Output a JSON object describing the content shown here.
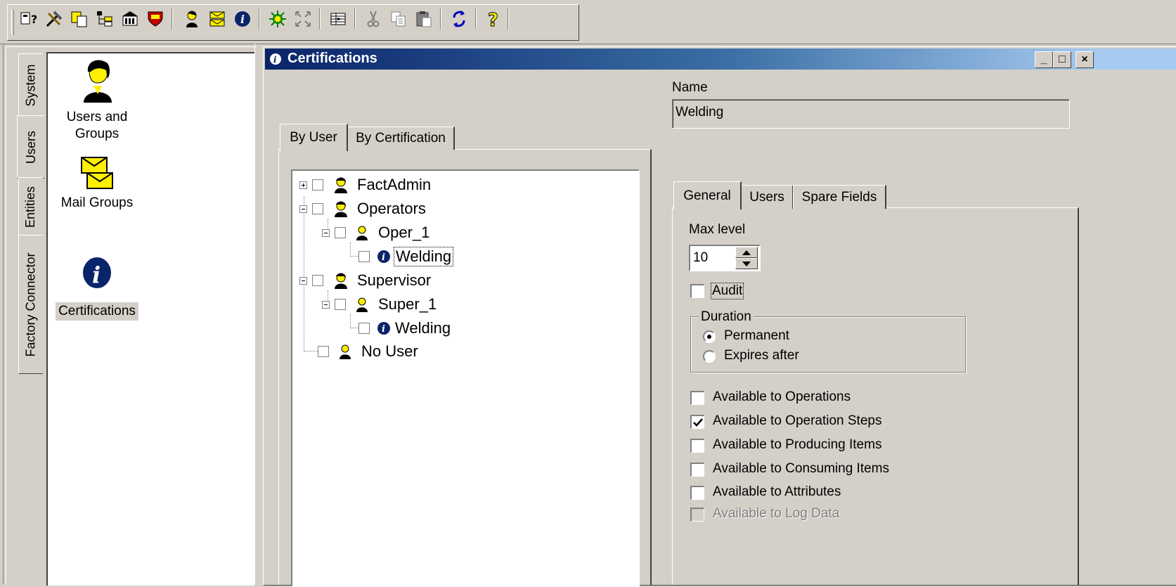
{
  "toolbar": {
    "buttons": [
      {
        "icon": "whats-this-icon"
      },
      {
        "icon": "tools-icon"
      },
      {
        "icon": "copy-objects-icon"
      },
      {
        "icon": "tree-icon"
      },
      {
        "icon": "building-icon"
      },
      {
        "icon": "shield-icon"
      },
      {
        "icon": "user-icon"
      },
      {
        "icon": "mail-icon"
      },
      {
        "icon": "info-icon"
      },
      {
        "icon": "gear-icon"
      },
      {
        "icon": "expand-icon"
      },
      {
        "icon": "grid-icon"
      },
      {
        "icon": "cut-icon"
      },
      {
        "icon": "copy-icon"
      },
      {
        "icon": "paste-icon"
      },
      {
        "icon": "refresh-icon"
      },
      {
        "icon": "help-icon"
      }
    ]
  },
  "sidebar": {
    "tabs": [
      "System",
      "Users",
      "Entities",
      "Factory Connector"
    ],
    "active_tab": "Users",
    "items": [
      {
        "label_line1": "Users and",
        "label_line2": "Groups",
        "icon": "user-icon"
      },
      {
        "label": "Mail Groups",
        "icon": "mail-icon"
      },
      {
        "label": "Certifications",
        "icon": "info-icon",
        "selected": true
      }
    ]
  },
  "window": {
    "title": "Certifications",
    "min": "_",
    "max": "□",
    "close": "×"
  },
  "left_tabs": [
    "By User",
    "By Certification"
  ],
  "tree": [
    {
      "label": "FactAdmin",
      "expander": "plus"
    },
    {
      "label": "Operators",
      "expander": "minus"
    },
    {
      "label": "Oper_1",
      "expander": "minus"
    },
    {
      "label": "Welding",
      "focused": true
    },
    {
      "label": "Supervisor",
      "expander": "minus"
    },
    {
      "label": "Super_1",
      "expander": "minus"
    },
    {
      "label": "Welding"
    },
    {
      "label": "No User"
    }
  ],
  "form": {
    "name_label": "Name",
    "name_value": "Welding",
    "tabs": [
      "General",
      "Users",
      "Spare Fields"
    ],
    "max_level_label": "Max level",
    "max_level_value": "10",
    "audit_label": "Audit",
    "audit_checked": false,
    "duration": {
      "legend": "Duration",
      "options": [
        "Permanent",
        "Expires after"
      ],
      "selected": "Permanent"
    },
    "availability": [
      {
        "label": "Available to Operations",
        "checked": false
      },
      {
        "label": "Available to Operation Steps",
        "checked": true
      },
      {
        "label": "Available to Producing Items",
        "checked": false
      },
      {
        "label": "Available to Consuming Items",
        "checked": false
      },
      {
        "label": "Available to Attributes",
        "checked": false
      },
      {
        "label": "Available to Log Data",
        "checked": false,
        "disabled": true
      }
    ]
  }
}
